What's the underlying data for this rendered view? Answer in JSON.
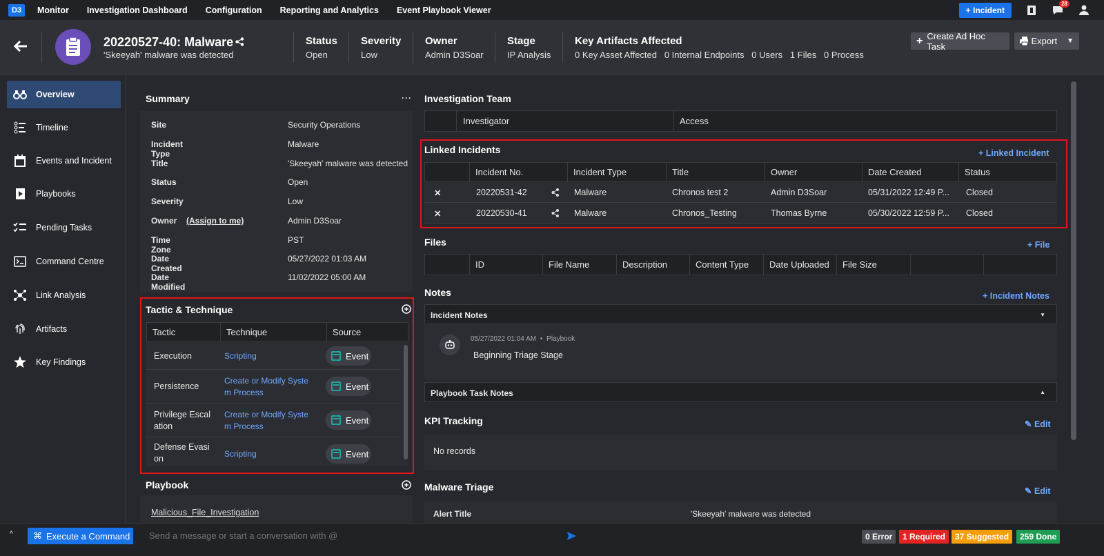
{
  "nav": {
    "logo": "D3",
    "items": [
      "Monitor",
      "Investigation Dashboard",
      "Configuration",
      "Reporting and Analytics",
      "Event Playbook Viewer"
    ],
    "incident_button": "+ Incident",
    "notification_count": "28"
  },
  "header": {
    "title": "20220527-40: Malware",
    "subtitle": "'Skeeyah' malware was detected",
    "columns": [
      {
        "label": "Status",
        "value": "Open"
      },
      {
        "label": "Severity",
        "value": "Low"
      },
      {
        "label": "Owner",
        "value": "Admin D3Soar"
      },
      {
        "label": "Stage",
        "value": "IP Analysis"
      },
      {
        "label": "Key Artifacts Affected",
        "value": "0 Key Asset Affected   0 Internal Endpoints   0 Users   1 Files   0 Process"
      }
    ],
    "create_task_button": "Create Ad Hoc Task",
    "export_button": "Export"
  },
  "sidebar": {
    "items": [
      {
        "label": "Overview",
        "icon": "binoculars-icon",
        "active": true
      },
      {
        "label": "Timeline",
        "icon": "timeline-icon"
      },
      {
        "label": "Events and Incident",
        "icon": "calendar-icon"
      },
      {
        "label": "Playbooks",
        "icon": "playbook-icon"
      },
      {
        "label": "Pending Tasks",
        "icon": "checklist-icon"
      },
      {
        "label": "Command Centre",
        "icon": "terminal-icon"
      },
      {
        "label": "Link Analysis",
        "icon": "network-icon"
      },
      {
        "label": "Artifacts",
        "icon": "fingerprint-icon"
      },
      {
        "label": "Key Findings",
        "icon": "star-icon"
      }
    ]
  },
  "summary": {
    "title": "Summary",
    "assign_link": "(Assign to me)",
    "rows": [
      {
        "key": "Site",
        "value": "Security Operations"
      },
      {
        "key": "Incident Type",
        "value": "Malware"
      },
      {
        "key": "Title",
        "value": "'Skeeyah' malware was detected"
      },
      {
        "key": "Status",
        "value": "Open"
      },
      {
        "key": "Severity",
        "value": "Low"
      },
      {
        "key": "Owner",
        "value": "Admin D3Soar"
      },
      {
        "key": "Time Zone",
        "value": "PST"
      },
      {
        "key": "Date Created",
        "value": "05/27/2022 01:03 AM"
      },
      {
        "key": "Date Modified",
        "value": "11/02/2022 05:00 AM"
      }
    ]
  },
  "tactic": {
    "title": "Tactic & Technique",
    "headers": [
      "Tactic",
      "Technique",
      "Source"
    ],
    "rows": [
      {
        "tactic": [
          "Execution"
        ],
        "technique": [
          "Scripting"
        ],
        "source": "Event"
      },
      {
        "tactic": [
          "Persistence"
        ],
        "technique": [
          "Create or Modify Syste",
          "m Process"
        ],
        "source": "Event"
      },
      {
        "tactic": [
          "Privilege Escal",
          "ation"
        ],
        "technique": [
          "Create or Modify Syste",
          "m Process"
        ],
        "source": "Event"
      },
      {
        "tactic": [
          "Defense Evasi",
          "on"
        ],
        "technique": [
          "Scripting"
        ],
        "source": "Event"
      }
    ]
  },
  "playbook": {
    "title": "Playbook",
    "link": "Malicious_File_Investigation"
  },
  "team": {
    "title": "Investigation Team",
    "headers": [
      "Investigator",
      "Access"
    ]
  },
  "linked": {
    "title": "Linked Incidents",
    "add": "+ Linked Incident",
    "headers": [
      "Incident No.",
      "Incident Type",
      "Title",
      "Owner",
      "Date Created",
      "Status"
    ],
    "rows": [
      {
        "no": "20220531-42",
        "type": "Malware",
        "title": "Chronos test 2",
        "owner": "Admin D3Soar",
        "date": "05/31/2022 12:49 P...",
        "status": "Closed"
      },
      {
        "no": "20220530-41",
        "type": "Malware",
        "title": "Chronos_Testing",
        "owner": "Thomas Byrne",
        "date": "05/30/2022 12:59 P...",
        "status": "Closed"
      }
    ]
  },
  "files": {
    "title": "Files",
    "add": "+ File",
    "headers": [
      "ID",
      "File Name",
      "Description",
      "Content Type",
      "Date Uploaded",
      "File Size"
    ]
  },
  "notes": {
    "title": "Notes",
    "add": "+ Incident Notes",
    "incident_notes": "Incident Notes",
    "note_time": "05/27/2022 01:04 AM",
    "note_source": "Playbook",
    "note_text": "Beginning Triage Stage",
    "playbook_task_notes": "Playbook Task Notes"
  },
  "kpi": {
    "title": "KPI Tracking",
    "edit": "Edit",
    "empty": "No records"
  },
  "triage": {
    "title": "Malware Triage",
    "edit": "Edit",
    "alert_key": "Alert Title",
    "alert_value": "'Skeeyah' malware was detected"
  },
  "bottom": {
    "execute": "Execute a Command",
    "message_placeholder": "Send a message or start a conversation with @",
    "error": "0 Error",
    "required": "1 Required",
    "suggested": "37 Suggested",
    "done": "259 Done"
  }
}
